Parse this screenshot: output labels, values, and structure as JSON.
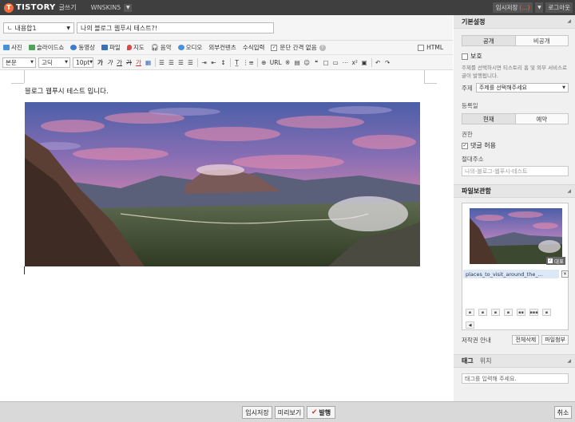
{
  "header": {
    "logo_letter": "T",
    "logo_text": "TISTORY",
    "logo_sub": "글쓰기",
    "blog_name": "WNSKIN5",
    "autosave_label": "임시저장",
    "autosave_count": "(...)",
    "logout_label": "로그아웃"
  },
  "editor": {
    "category": "내용합1",
    "title": "나의 블로그 웹푸시 테스트?!",
    "media_toolbar": [
      {
        "label": "사진",
        "icon": "photo-icon",
        "color": "#4a8fd8"
      },
      {
        "label": "슬라이드쇼",
        "icon": "slideshow-icon",
        "color": "#4fa35a"
      },
      {
        "label": "동영상",
        "icon": "video-icon",
        "color": "#3d7cc9"
      },
      {
        "label": "파일",
        "icon": "file-icon",
        "color": "#3b6fb6"
      },
      {
        "label": "지도",
        "icon": "map-icon",
        "color": "#d84a4a"
      },
      {
        "label": "음악",
        "icon": "music-icon",
        "color": "#555555"
      },
      {
        "label": "오디오",
        "icon": "audio-icon",
        "color": "#4a8fd8"
      },
      {
        "label": "외부컨텐츠",
        "icon": "",
        "color": ""
      },
      {
        "label": "수식입력",
        "icon": "",
        "color": ""
      }
    ],
    "paragraph_option": "문단 간격 없음",
    "paragraph_checked": "✓",
    "html_label": "HTML",
    "format_select": "본문",
    "font_select": "고딕",
    "size_select": "10pt",
    "format_buttons": [
      "가",
      "가",
      "가",
      "가",
      "가"
    ],
    "url_label": "URL",
    "body_text": "블로그 웹푸시 테스트 입니다."
  },
  "sidebar": {
    "basic_title": "기본설정",
    "visibility": {
      "public": "공개",
      "private": "비공개"
    },
    "protect_label": "보호",
    "protect_desc": "주제를 선택하시면 티스토리 홈 및 외부 서비스로 글이 발행됩니다.",
    "topic_label": "주제",
    "topic_placeholder": "주제를 선택해주세요",
    "date_label": "등록일",
    "date_now": "현재",
    "date_reserve": "예약",
    "perm_label": "권한",
    "comment_label": "댓글 허용",
    "comment_checked": "✓",
    "permalink_label": "절대주소",
    "permalink_value": "나의-블로그-웹푸시-테스트",
    "file_title": "파일보관함",
    "representative_label": "대표",
    "file_name": "places_to_visit_around_the_...",
    "copyright_label": "저작권 안내",
    "delete_all_label": "전체삭제",
    "attach_label": "파일첨부",
    "tag_tab": "태그",
    "location_tab": "위치",
    "tag_placeholder": "태그를 입력해 주세요."
  },
  "footer": {
    "temp_save": "임시저장",
    "preview": "미리보기",
    "publish": "발행",
    "cancel": "취소"
  }
}
